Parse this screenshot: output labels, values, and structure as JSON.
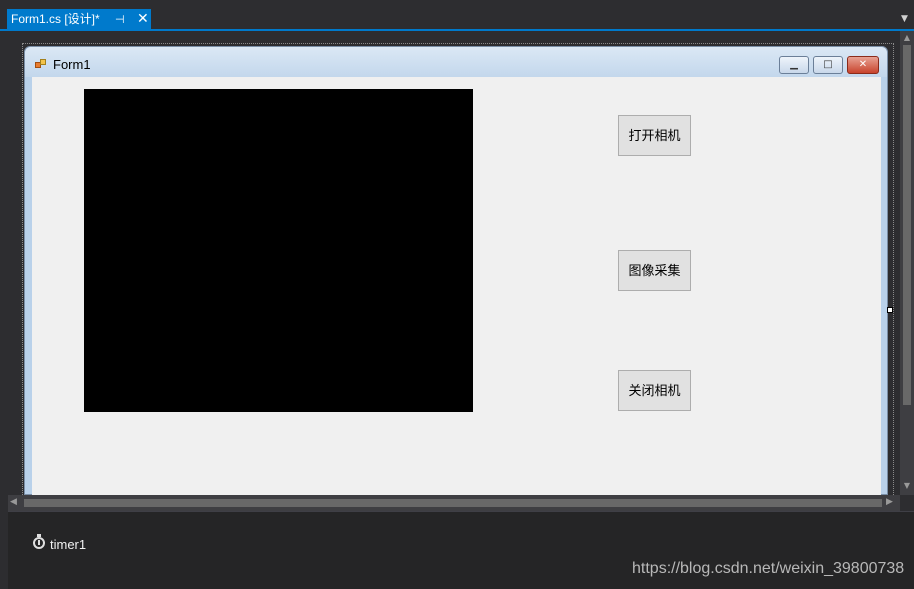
{
  "tab": {
    "title": "Form1.cs [设计]*",
    "pin_glyph": "⊣",
    "close_glyph": "✕"
  },
  "form": {
    "title": "Form1",
    "minimize_glyph": "▁",
    "maximize_glyph": "□",
    "close_glyph": "✕",
    "buttons": {
      "open_camera": "打开相机",
      "capture_image": "图像采集",
      "close_camera": "关闭相机"
    }
  },
  "tray": {
    "timer_label": "timer1"
  },
  "watermark": "https://blog.csdn.net/weixin_39800738",
  "colors": {
    "tab_accent": "#007acc",
    "ide_background": "#2d2d30",
    "form_client": "#f0f0f0",
    "picturebox": "#000000"
  }
}
